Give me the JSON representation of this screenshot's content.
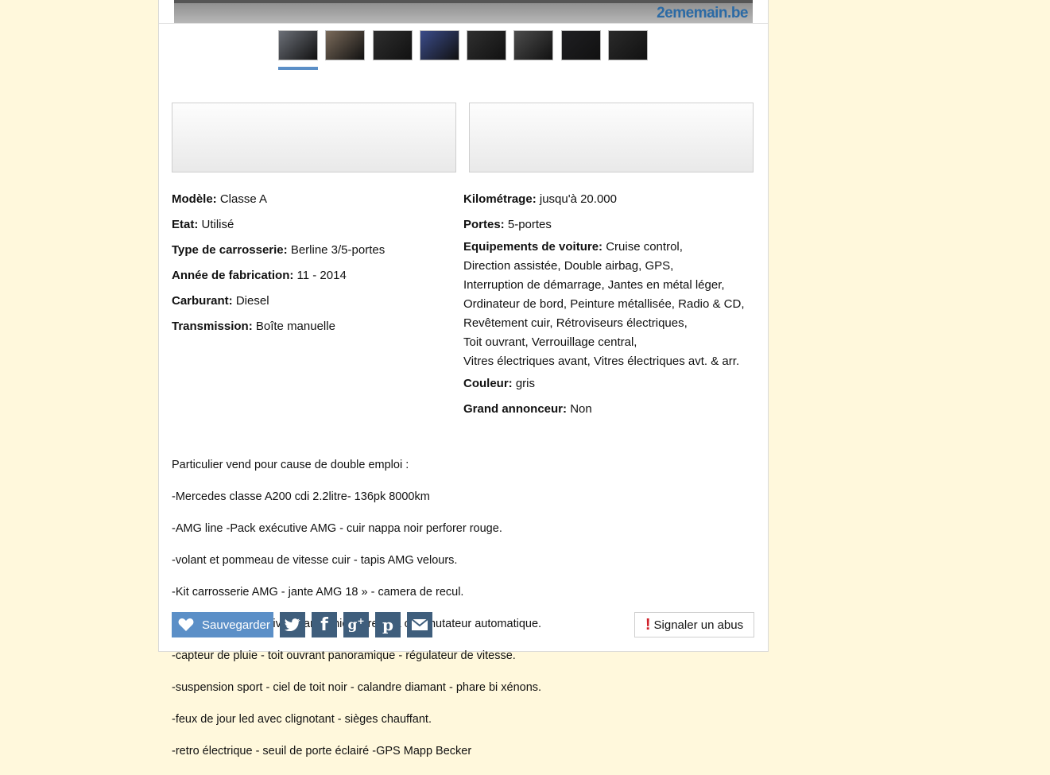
{
  "hero": {
    "logo": "2ememain.be"
  },
  "thumbnails": [
    {
      "color": "#6b6f77"
    },
    {
      "color": "#7a6a5a"
    },
    {
      "color": "#2e2e2e"
    },
    {
      "color": "#3b4c8a"
    },
    {
      "color": "#2f2f2f"
    },
    {
      "color": "#4c4c4c"
    },
    {
      "color": "#1f1f22"
    },
    {
      "color": "#2a2a2a"
    }
  ],
  "specs_left": [
    {
      "label": "Modèle:",
      "value": "Classe A"
    },
    {
      "label": "Etat:",
      "value": "Utilisé"
    },
    {
      "label": "Type de carrosserie:",
      "value": "Berline 3/5-portes"
    },
    {
      "label": "Année de fabrication:",
      "value": "11 - 2014"
    },
    {
      "label": "Carburant:",
      "value": "Diesel"
    },
    {
      "label": "Transmission:",
      "value": "Boîte manuelle"
    }
  ],
  "specs_right": {
    "kilometrage": {
      "label": "Kilométrage:",
      "value": "jusqu'à 20.000"
    },
    "portes": {
      "label": "Portes:",
      "value": "5-portes"
    },
    "equipements": {
      "label": "Equipements de voiture:",
      "lines": [
        "Cruise control,",
        "Direction assistée, Double airbag, GPS,",
        "Interruption de démarrage, Jantes en métal léger,",
        "Ordinateur de bord, Peinture métallisée, Radio & CD,",
        "Revêtement cuir, Rétroviseurs électriques,",
        "Toit ouvrant, Verrouillage central,",
        "Vitres électriques avant, Vitres électriques avt. & arr."
      ]
    },
    "couleur": {
      "label": "Couleur:",
      "value": "gris"
    },
    "grand_annonceur": {
      "label": "Grand annonceur:",
      "value": "Non"
    }
  },
  "description": [
    "Particulier vend pour cause de double emploi :",
    "-Mercedes classe A200 cdi 2.2litre- 136pk 8000km",
    "-AMG line -Pack exécutive AMG - cuir nappa noir perforer rouge.",
    "-volant et pommeau de vitesse cuir - tapis AMG velours.",
    "-Kit carrosserie AMG - jante AMG 18 » - camera de recul.",
    "-aide au parking active »parktronic » - retro a commutateur automatique.",
    "-capteur de pluie - toit ouvrant panoramique - régulateur de vitesse.",
    "-suspension sport - ciel de toit noir - calandre diamant - phare bi xénons.",
    "-feux de jour led avec clignotant - sièges chauffant.",
    "-retro électrique - seuil de porte éclairé -GPS Mapp Becker"
  ],
  "actions": {
    "save_label": "Sauvegarder",
    "report_label": "Signaler un abus",
    "share_icons": [
      "twitter-icon",
      "facebook-icon",
      "google-plus-icon",
      "pinterest-icon",
      "email-icon"
    ]
  }
}
